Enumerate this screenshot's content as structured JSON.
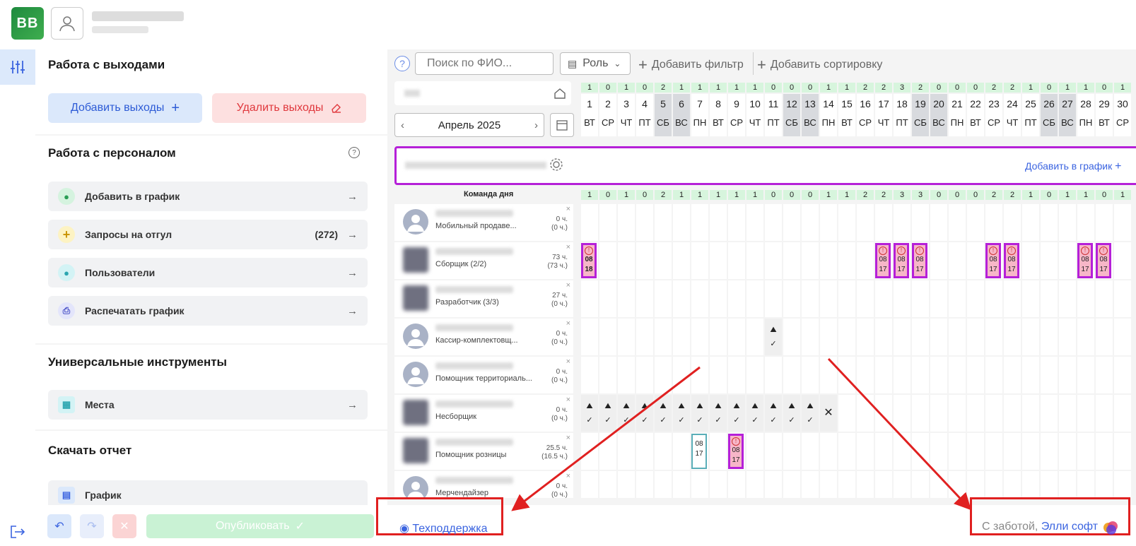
{
  "header": {
    "logo_text": "BB",
    "user_name": "",
    "user_sub": ""
  },
  "sidebar": {
    "section1": {
      "title": "Работа с выходами",
      "add_label": "Добавить выходы",
      "delete_label": "Удалить выходы"
    },
    "section2": {
      "title": "Работа с персоналом",
      "items": [
        {
          "label": "Добавить в график",
          "count": ""
        },
        {
          "label": "Запросы на отгул",
          "count": "(272)"
        },
        {
          "label": "Пользователи",
          "count": ""
        },
        {
          "label": "Распечатать график",
          "count": ""
        }
      ]
    },
    "section3": {
      "title": "Универсальные инструменты",
      "items": [
        {
          "label": "Места"
        }
      ]
    },
    "section4": {
      "title": "Скачать отчет",
      "items": [
        {
          "label": "График"
        }
      ]
    },
    "publish_label": "Опубликовать"
  },
  "toolbar": {
    "search_placeholder": "Поиск по ФИО...",
    "role_label": "Роль",
    "add_filter": "Добавить фильтр",
    "add_sort": "Добавить сортировку"
  },
  "calendar": {
    "month": "Апрель 2025",
    "days": [
      1,
      2,
      3,
      4,
      5,
      6,
      7,
      8,
      9,
      10,
      11,
      12,
      13,
      14,
      15,
      16,
      17,
      18,
      19,
      20,
      21,
      22,
      23,
      24,
      25,
      26,
      27,
      28,
      29,
      30
    ],
    "weekdays": [
      "ВТ",
      "СР",
      "ЧТ",
      "ПТ",
      "СБ",
      "ВС",
      "ПН",
      "ВТ",
      "СР",
      "ЧТ",
      "ПТ",
      "СБ",
      "ВС",
      "ПН",
      "ВТ",
      "СР",
      "ЧТ",
      "ПТ",
      "СБ",
      "ВС",
      "ПН",
      "ВТ",
      "СР",
      "ЧТ",
      "ПТ",
      "СБ",
      "ВС",
      "ПН",
      "ВТ",
      "СР"
    ],
    "weekend_days": [
      5,
      6,
      12,
      13,
      19,
      20,
      26,
      27
    ],
    "top_counts": [
      1,
      0,
      1,
      0,
      2,
      1,
      1,
      1,
      1,
      1,
      0,
      0,
      0,
      1,
      1,
      2,
      2,
      3,
      2,
      0,
      0,
      0,
      2,
      2,
      1,
      0,
      1,
      1,
      0,
      1
    ],
    "team_counts": [
      1,
      0,
      1,
      0,
      2,
      1,
      1,
      1,
      1,
      1,
      0,
      0,
      0,
      1,
      1,
      2,
      2,
      3,
      3,
      0,
      0,
      0,
      2,
      2,
      1,
      0,
      1,
      1,
      0,
      1
    ],
    "team_label": "Команда дня",
    "add_to_schedule": "Добавить в график"
  },
  "employees": [
    {
      "role": "Мобильный продаве...",
      "hours": "0 ч.",
      "hours2": "(0 ч.)",
      "photo": false
    },
    {
      "role": "Сборщик (2/2)",
      "hours": "73 ч.",
      "hours2": "(73 ч.)",
      "photo": true
    },
    {
      "role": "Разработчик (3/3)",
      "hours": "27 ч.",
      "hours2": "(0 ч.)",
      "photo": true
    },
    {
      "role": "Кассир-комплектовщ...",
      "hours": "0 ч.",
      "hours2": "(0 ч.)",
      "photo": false
    },
    {
      "role": "Помощник территориаль...",
      "hours": "0 ч.",
      "hours2": "(0 ч.)",
      "photo": false
    },
    {
      "role": "Несборщик",
      "hours": "0 ч.",
      "hours2": "(0 ч.)",
      "photo": true
    },
    {
      "role": "Помощник розницы",
      "hours": "25.5 ч.",
      "hours2": "(16.5 ч.)",
      "photo": true
    },
    {
      "role": "Мерчендайзер",
      "hours": "0 ч.",
      "hours2": "(0 ч.)",
      "photo": false
    }
  ],
  "shift_start_first": "08",
  "shift_end_first": "18",
  "shift_start": "08",
  "shift_end": "17",
  "footer": {
    "support": "Техподдержка",
    "care_prefix": "С заботой, ",
    "care_brand": "Элли софт"
  }
}
